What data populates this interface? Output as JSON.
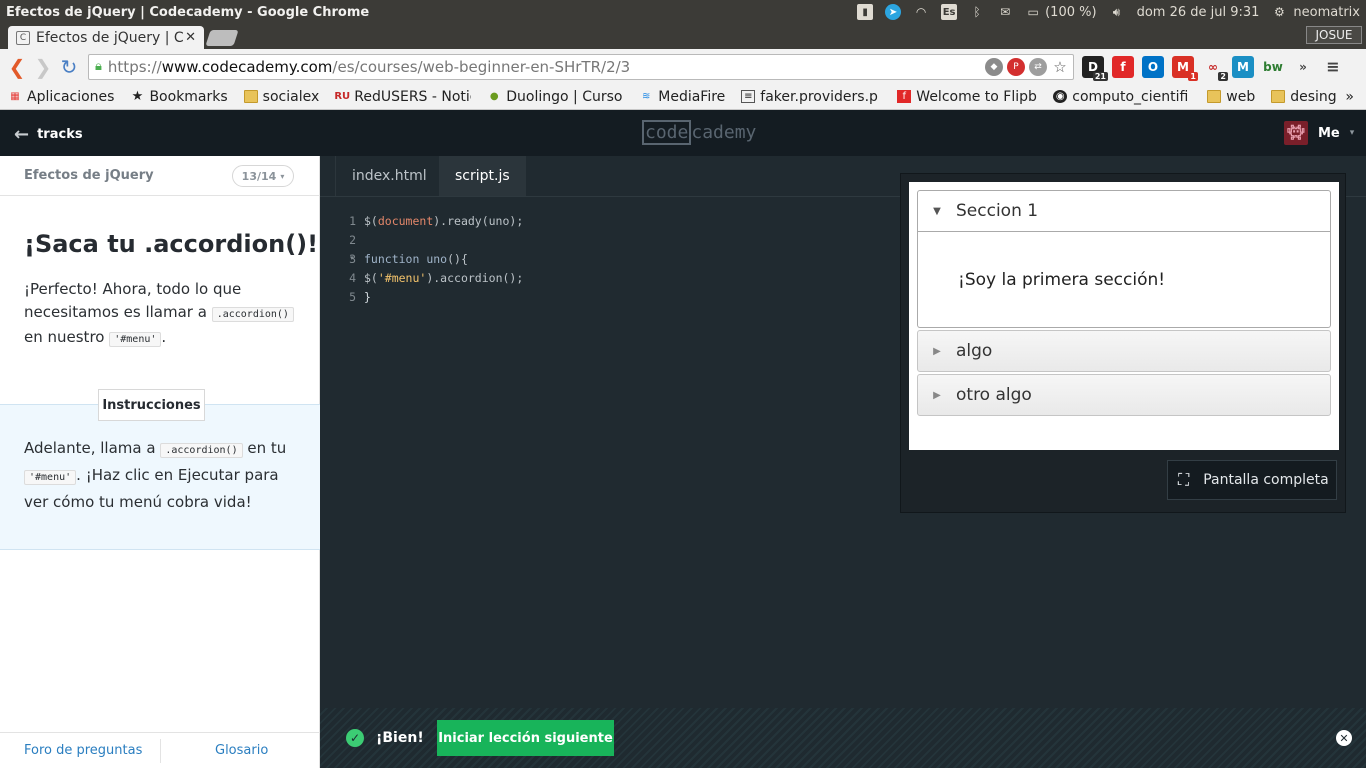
{
  "os_panel": {
    "window_title": "Efectos de jQuery | Codecademy - Google Chrome",
    "keyboard_layout": "Es",
    "battery": "(100 %)",
    "clock": "dom 26 de jul  9:31",
    "user": "neomatrix"
  },
  "browser": {
    "tab_title": "Efectos de jQuery | C",
    "profile": "JOSUE",
    "url_scheme": "https://",
    "url_host": "www.codecademy.com",
    "url_path": "/es/courses/web-beginner-en-SHrTR/2/3",
    "extension_badges": [
      "21",
      "1",
      "2"
    ],
    "bookmarks": [
      {
        "label": "Aplicaciones",
        "icon": "apps-grid-icon"
      },
      {
        "label": "Bookmarks",
        "icon": "star-icon"
      },
      {
        "label": "socialex",
        "icon": "folder-icon"
      },
      {
        "label": "RedUSERS - Notic",
        "icon": "redusers-icon"
      },
      {
        "label": "Duolingo | Curso",
        "icon": "duolingo-icon"
      },
      {
        "label": "MediaFire",
        "icon": "mediafire-icon"
      },
      {
        "label": "faker.providers.p",
        "icon": "document-icon"
      },
      {
        "label": "Welcome to Flipb",
        "icon": "flipboard-icon"
      },
      {
        "label": "computo_cientifi",
        "icon": "github-icon"
      },
      {
        "label": "web",
        "icon": "folder-icon"
      },
      {
        "label": "desing",
        "icon": "folder-icon"
      }
    ]
  },
  "header": {
    "back_label": "tracks",
    "logo_boxed": "code",
    "logo_rest": "cademy",
    "user_label": "Me"
  },
  "lesson": {
    "course_name": "Efectos de jQuery",
    "progress": "13/14",
    "title": "¡Saca tu .accordion()!",
    "intro_1": "¡Perfecto! Ahora, todo lo que necesitamos es llamar a",
    "intro_code_1": ".accordion()",
    "intro_2": "en nuestro",
    "intro_code_2": "'#menu'",
    "intro_3": ".",
    "instructions_label": "Instrucciones",
    "instr_1": "Adelante, llama a",
    "instr_code_1": ".accordion()",
    "instr_2": "en tu",
    "instr_code_2": "'#menu'",
    "instr_3": ". ¡Haz clic en Ejecutar para ver cómo tu menú cobra vida!",
    "footer_left": "Foro de preguntas",
    "footer_right": "Glosario"
  },
  "editor": {
    "tabs": [
      {
        "label": "index.html",
        "active": false
      },
      {
        "label": "script.js",
        "active": true
      }
    ],
    "line_numbers": [
      "1",
      "2",
      "3",
      "4",
      "5"
    ],
    "code": {
      "l1_a": "$(",
      "l1_b": "document",
      "l1_c": ").ready(uno);",
      "l3_a": "function",
      "l3_b": " uno",
      "l3_c": "(){",
      "l4_a": "$(",
      "l4_b": "'#menu'",
      "l4_c": ").accordion();",
      "l5": "}"
    }
  },
  "preview": {
    "sections": [
      {
        "title": "Seccion 1",
        "expanded": true,
        "content": "¡Soy la primera sección!"
      },
      {
        "title": "algo",
        "expanded": false
      },
      {
        "title": "otro algo",
        "expanded": false
      }
    ],
    "fullscreen_label": "Pantalla completa"
  },
  "bottom_bar": {
    "status": "¡Bien!",
    "next_button": "Iniciar lección siguiente"
  }
}
